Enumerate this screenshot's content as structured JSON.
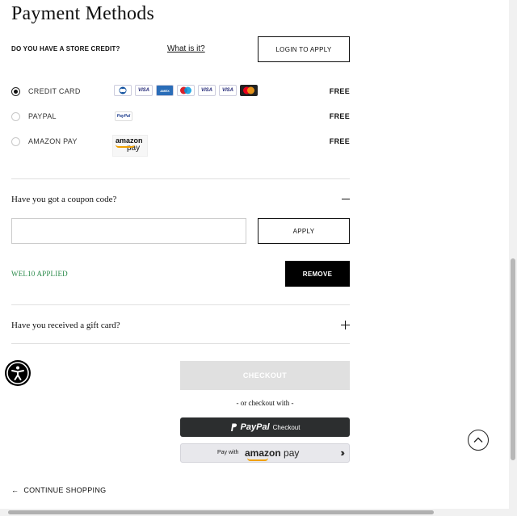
{
  "page": {
    "title": "Payment Methods"
  },
  "store_credit": {
    "question": "DO YOU HAVE A STORE CREDIT?",
    "info_link": "What is it?",
    "login_button": "LOGIN TO APPLY"
  },
  "payment_methods": [
    {
      "name": "CREDIT CARD",
      "price": "FREE",
      "selected": true,
      "logos": [
        "diners-club-icon",
        "visa-icon",
        "amex-icon",
        "maestro-icon",
        "visa-electron-icon",
        "visa-debit-icon",
        "mastercard-icon"
      ],
      "logo_text": {
        "visa": "VISA",
        "amex": "AMEX",
        "visa_electron": "VISA",
        "visa_debit": "VISA"
      }
    },
    {
      "name": "PAYPAL",
      "price": "FREE",
      "selected": false,
      "logos": [
        "paypal-icon"
      ],
      "logo_text": {
        "paypal": "PayPal"
      }
    },
    {
      "name": "AMAZON PAY",
      "price": "FREE",
      "selected": false,
      "logos": [
        "amazon-pay-icon"
      ],
      "logo_text": {
        "line1": "amazon",
        "line2": "pay"
      }
    }
  ],
  "coupon": {
    "question": "Have you got a coupon code?",
    "input_value": "",
    "input_placeholder": "",
    "apply_button": "APPLY",
    "applied_text": "WEL10 APPLIED",
    "remove_button": "REMOVE"
  },
  "gift_card": {
    "question": "Have you received a gift card?"
  },
  "checkout": {
    "button": "CHECKOUT",
    "alt_text": "- or checkout with -",
    "paypal_logo": "PayPal",
    "paypal_label": "Checkout",
    "amazon_prefix": "Pay with",
    "amazon_brand": "amazon",
    "amazon_pay": "pay",
    "amazon_chevron": "››"
  },
  "footer": {
    "continue_shopping": "CONTINUE SHOPPING",
    "arrow": "←"
  },
  "colors": {
    "applied_green": "#2a8a4a",
    "checkout_disabled": "#e0e0e0",
    "paypal_dark": "#2c2e2f",
    "amazon_orange": "#f0a000"
  }
}
